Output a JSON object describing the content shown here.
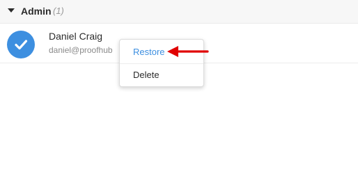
{
  "group": {
    "title": "Admin",
    "count": "(1)"
  },
  "user": {
    "name": "Daniel Craig",
    "email": "daniel@proofhub"
  },
  "context_menu": {
    "restore_label": "Restore",
    "delete_label": "Delete"
  },
  "colors": {
    "accent": "#3d8fe0",
    "annotation_arrow": "#e00000"
  },
  "icons": {
    "avatar": "check-icon",
    "group_toggle": "caret-down-icon"
  }
}
